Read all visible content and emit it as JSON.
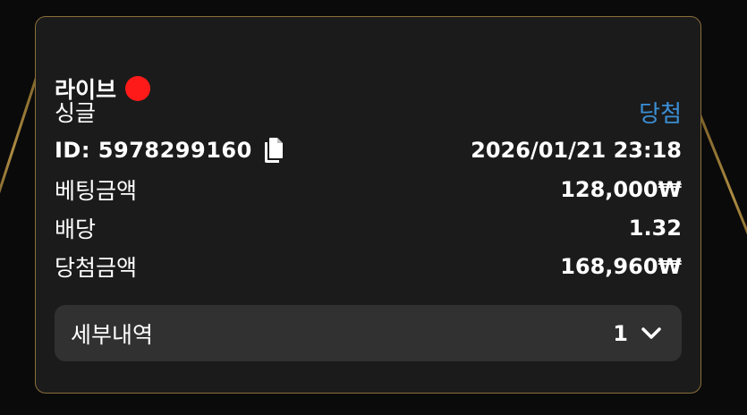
{
  "bet": {
    "type_label": "라이브",
    "category": "싱글",
    "status": "당첨",
    "id_label": "ID: 5978299160",
    "datetime": "2026/01/21 23:18"
  },
  "rows": [
    {
      "label": "베팅금액",
      "value": "128,000₩"
    },
    {
      "label": "배당",
      "value": "1.32"
    },
    {
      "label": "당첨금액",
      "value": "168,960₩"
    }
  ],
  "details": {
    "label": "세부내역",
    "count": "1"
  },
  "colors": {
    "status_win": "#3b8fd6",
    "live_dot": "#ff1a1a",
    "card_border": "#8a6f3a"
  },
  "icons": {
    "copy": "copy-icon",
    "chevron": "chevron-down-icon",
    "live": "live-dot-icon"
  }
}
